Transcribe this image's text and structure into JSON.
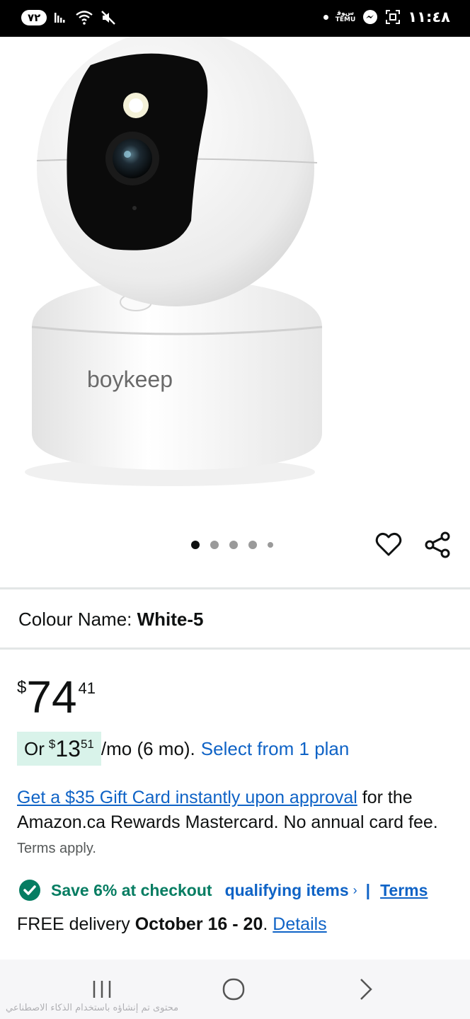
{
  "status_bar": {
    "battery": "٧٢",
    "time": "١١:٤٨",
    "app_label_top": "ﺱﻮﻗ",
    "app_label_bottom": "TEMU"
  },
  "product": {
    "brand_on_image": "boykeep",
    "carousel_count": 5,
    "carousel_active": 0
  },
  "colour": {
    "label": "Colour Name: ",
    "value": "White-5"
  },
  "price": {
    "symbol": "$",
    "whole": "74",
    "fraction": "41"
  },
  "installment": {
    "prefix": "Or",
    "symbol": "$",
    "whole": "13",
    "fraction": "51",
    "suffix": "/mo (6 mo).",
    "link": "Select from 1 plan"
  },
  "gift_card": {
    "link": "Get a $35 Gift Card instantly upon approval",
    "text": " for the Amazon.ca Rewards Mastercard. No annual card fee. ",
    "small": "Terms apply."
  },
  "savings": {
    "text": "Save 6% at checkout",
    "link": "qualifying items",
    "chevron": "›",
    "separator": "|",
    "terms": "Terms"
  },
  "delivery": {
    "prefix": "FREE delivery ",
    "dates": "October 16 - 20",
    "period": ". ",
    "link": "Details"
  },
  "nav": {
    "ai_notice": "محتوى تم إنشاؤه باستخدام الذكاء الاصطناعي"
  },
  "colors": {
    "link": "#0f63c6",
    "success": "#067d62",
    "chip": "#d9f3ea"
  }
}
